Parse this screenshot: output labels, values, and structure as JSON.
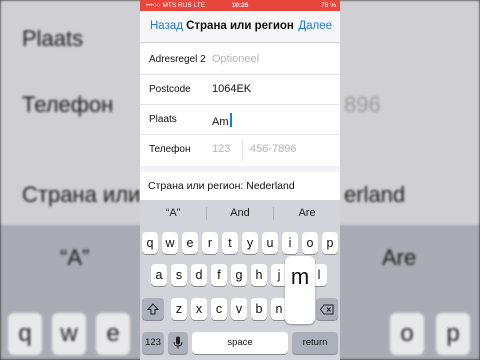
{
  "status": {
    "carrier": "•••○○ MTS RUS  LTE",
    "time": "10:26",
    "battery": "76 %"
  },
  "nav": {
    "back": "Назад",
    "title": "Страна или регион",
    "next": "Далее"
  },
  "form": {
    "rows": [
      {
        "label": "Adresregel 2",
        "value": "",
        "placeholder": "Optioneel"
      },
      {
        "label": "Postcode",
        "value": "1064EK",
        "placeholder": ""
      },
      {
        "label": "Plaats",
        "value": "Am",
        "placeholder": ""
      },
      {
        "label": "Телефон",
        "value": "",
        "placeholder": "123",
        "placeholder2": "456-7896"
      }
    ]
  },
  "country": "Страна или регион: Nederland",
  "keyboard": {
    "suggestions": [
      "“A”",
      "And",
      "Are"
    ],
    "row1": [
      "q",
      "w",
      "e",
      "r",
      "t",
      "y",
      "u",
      "i",
      "o",
      "p"
    ],
    "row2": [
      "a",
      "s",
      "d",
      "f",
      "g",
      "h",
      "j",
      "k",
      "l"
    ],
    "row3": [
      "z",
      "x",
      "c",
      "v",
      "b",
      "n",
      "m"
    ],
    "numbers": "123",
    "space": "space",
    "return": "return",
    "popup": "m"
  },
  "background": {
    "plaats": "Plaats",
    "telefoon": "Телефон",
    "phone_digits": "896",
    "country_left": "Страна или",
    "country_right": "erland",
    "sug_left": "“A”",
    "sug_right": "Are",
    "row1_left": [
      "q",
      "w",
      "e"
    ],
    "row1_right": [
      "o",
      "p"
    ]
  },
  "colors": {
    "accent": "#1479f4",
    "status_bar": "#e8453c"
  }
}
